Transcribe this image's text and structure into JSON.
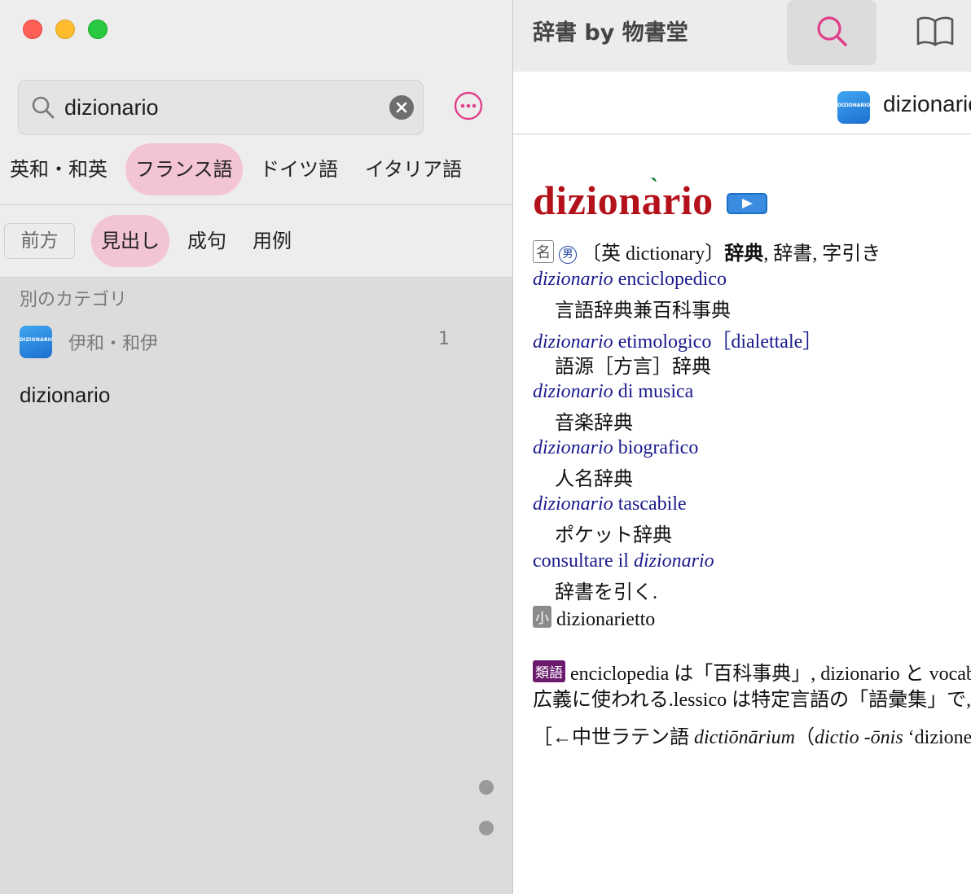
{
  "window": {
    "colors": {
      "accent_pink": "#f3c3d6",
      "headword_red": "#b3121b",
      "link_blue": "#1a1a8c"
    }
  },
  "sidebar": {
    "search": {
      "value": "dizionario",
      "placeholder": ""
    },
    "categories": [
      {
        "label": "英和・和英",
        "active": false
      },
      {
        "label": "フランス語",
        "active": true
      },
      {
        "label": "ドイツ語",
        "active": false
      },
      {
        "label": "イタリア語",
        "active": false
      }
    ],
    "match_mode": {
      "prefix_label": "前方",
      "tabs": [
        {
          "label": "見出し",
          "active": true
        },
        {
          "label": "成句",
          "active": false
        },
        {
          "label": "用例",
          "active": false
        }
      ]
    },
    "other_category_label": "別のカテゴリ",
    "other_category": {
      "icon_text": "DIZIONARIO",
      "name": "伊和・和伊",
      "count": "1"
    },
    "results": [
      "dizionario"
    ]
  },
  "toolbar": {
    "app_title": "辞書 by 物書堂",
    "icons": [
      "search-icon",
      "book-icon"
    ]
  },
  "entry": {
    "header_icon_text": "DIZIONARIO",
    "header_title": "dizionario",
    "headword": "dizionario",
    "accent_mark": "`",
    "pos": "名",
    "gender": "男",
    "definition_prefix": "〔英 dictionary〕",
    "definition_bold": "辞典",
    "definition_rest": ", 辞書, 字引き",
    "examples": [
      {
        "it": "dizionario",
        "rest": " enciclopedico",
        "ja": "言語辞典兼百科事典"
      },
      {
        "it": "dizionario",
        "rest": " etimologico［dialettale］",
        "ja": "語源［方言］辞典"
      },
      {
        "it": "dizionario",
        "rest": " di musica",
        "ja": "音楽辞典"
      },
      {
        "it": "dizionario",
        "rest": " biografico",
        "ja": "人名辞典"
      },
      {
        "it": "dizionario",
        "rest": " tascabile",
        "ja": "ポケット辞典"
      }
    ],
    "example_last": {
      "pre": "consultare il ",
      "it": "dizionario",
      "ja": "辞書を引く."
    },
    "diminutive_badge": "小",
    "diminutive": "dizionarietto",
    "synonym_badge": "類語",
    "synonym_line1": "enciclopedia は「百科事典」, dizionario と vocab",
    "synonym_line2": "広義に使われる.lessico は特定言語の「語彙集」で, no",
    "etymology_pre": "［←中世ラテン語 ",
    "etymology_it1": "dictiōnārium",
    "etymology_mid": "（",
    "etymology_it2": "dictio -ōnis",
    "etymology_post": " ‘dizione"
  }
}
